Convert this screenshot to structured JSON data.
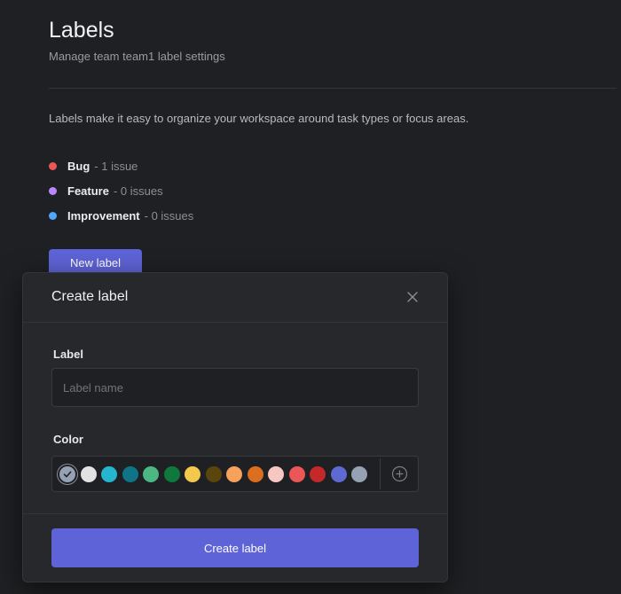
{
  "header": {
    "title": "Labels",
    "subtitle": "Manage team team1 label settings"
  },
  "description": "Labels make it easy to organize your workspace around task types or focus areas.",
  "labels": [
    {
      "name": "Bug",
      "count": "- 1 issue",
      "color": "#eb5757"
    },
    {
      "name": "Feature",
      "count": "- 0 issues",
      "color": "#bb87fc"
    },
    {
      "name": "Improvement",
      "count": "- 0 issues",
      "color": "#4ea7fc"
    }
  ],
  "new_label_button": "New label",
  "modal": {
    "title": "Create label",
    "close_icon": "close-icon",
    "label_field": {
      "label": "Label",
      "placeholder": "Label name",
      "value": ""
    },
    "color_field": {
      "label": "Color",
      "selected_index": 0,
      "swatches": [
        "#95a2b3",
        "#e2e2e2",
        "#26b5ce",
        "#0f7488",
        "#4cb782",
        "#0f783c",
        "#f2c94c",
        "#5a450d",
        "#f7a25b",
        "#db6e1f",
        "#f7c8c1",
        "#eb5757",
        "#c52828",
        "#5e6ad2",
        "#95a2b3"
      ],
      "add_icon": "plus-circle-icon"
    },
    "submit_label": "Create label"
  }
}
